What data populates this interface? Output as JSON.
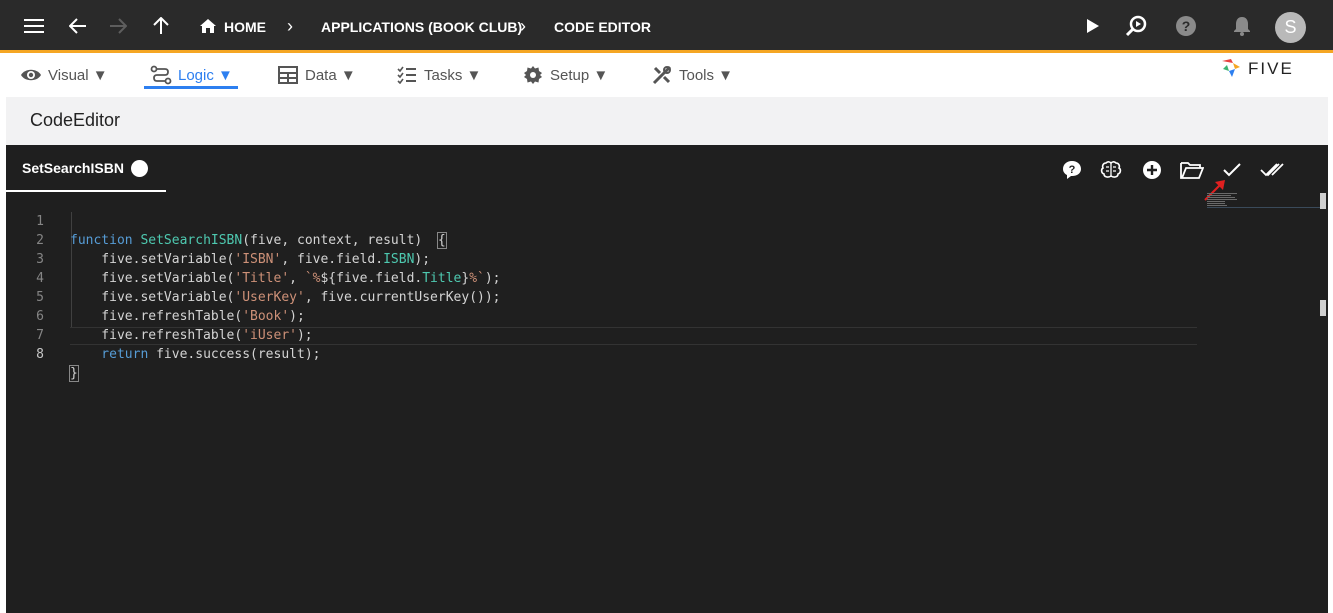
{
  "topbar": {
    "breadcrumbs": [
      {
        "label": "HOME"
      },
      {
        "label": "APPLICATIONS (BOOK CLUB)"
      },
      {
        "label": "CODE EDITOR"
      }
    ],
    "avatar_letter": "S",
    "icons": [
      "menu-icon",
      "back-arrow-icon",
      "forward-arrow-icon",
      "up-arrow-icon",
      "home-icon",
      "play-icon",
      "search-run-icon",
      "help-icon",
      "bell-icon"
    ]
  },
  "menu": {
    "items": [
      {
        "label": "Visual ▼",
        "icon": "eye-icon"
      },
      {
        "label": "Logic ▼",
        "icon": "flow-icon",
        "active": true
      },
      {
        "label": "Data ▼",
        "icon": "table-icon"
      },
      {
        "label": "Tasks ▼",
        "icon": "checklist-icon"
      },
      {
        "label": "Setup ▼",
        "icon": "gear-icon"
      },
      {
        "label": "Tools ▼",
        "icon": "tools-icon"
      }
    ],
    "active_color": "#2d7ff0"
  },
  "logo": {
    "text": "FIVE"
  },
  "page": {
    "title": "CodeEditor"
  },
  "editor": {
    "tab_label": "SetSearchISBN",
    "toolbar_icons": [
      "help-bubble-icon",
      "brain-icon",
      "add-circle-icon",
      "open-folder-icon",
      "check-icon",
      "double-check-icon"
    ],
    "lines": [
      {
        "n": "1"
      },
      {
        "n": "2"
      },
      {
        "n": "3"
      },
      {
        "n": "4"
      },
      {
        "n": "5"
      },
      {
        "n": "6"
      },
      {
        "n": "7"
      },
      {
        "n": "8"
      }
    ],
    "code": {
      "l1": {
        "kw": "function",
        "fn": "SetSearchISBN",
        "rest": "(five, context, result)  ",
        "brace": "{"
      },
      "l2": {
        "a": "    five.setVariable(",
        "s": "'ISBN'",
        "b": ", five.field.",
        "p": "ISBN",
        "c": ");"
      },
      "l3": {
        "a": "    five.setVariable(",
        "s": "'Title'",
        "b": ", ",
        "s2": "`%",
        "b2": "${five.field.",
        "p": "Title",
        "b3": "}",
        "s3": "%`",
        "c": ");"
      },
      "l4": {
        "a": "    five.setVariable(",
        "s": "'UserKey'",
        "b": ", five.currentUserKey());"
      },
      "l5": {
        "a": "    five.refreshTable(",
        "s": "'Book'",
        "b": ");"
      },
      "l6": {
        "a": "    five.refreshTable(",
        "s": "'iUser'",
        "b": ");"
      },
      "l7": {
        "kw": "    return",
        "b": " five.success(result);"
      },
      "l8": {
        "brace": "}"
      }
    },
    "bg_color": "#1f1f1f"
  },
  "colors": {
    "topbar": "#2a2a2a",
    "accent_border": "#f5a623"
  }
}
